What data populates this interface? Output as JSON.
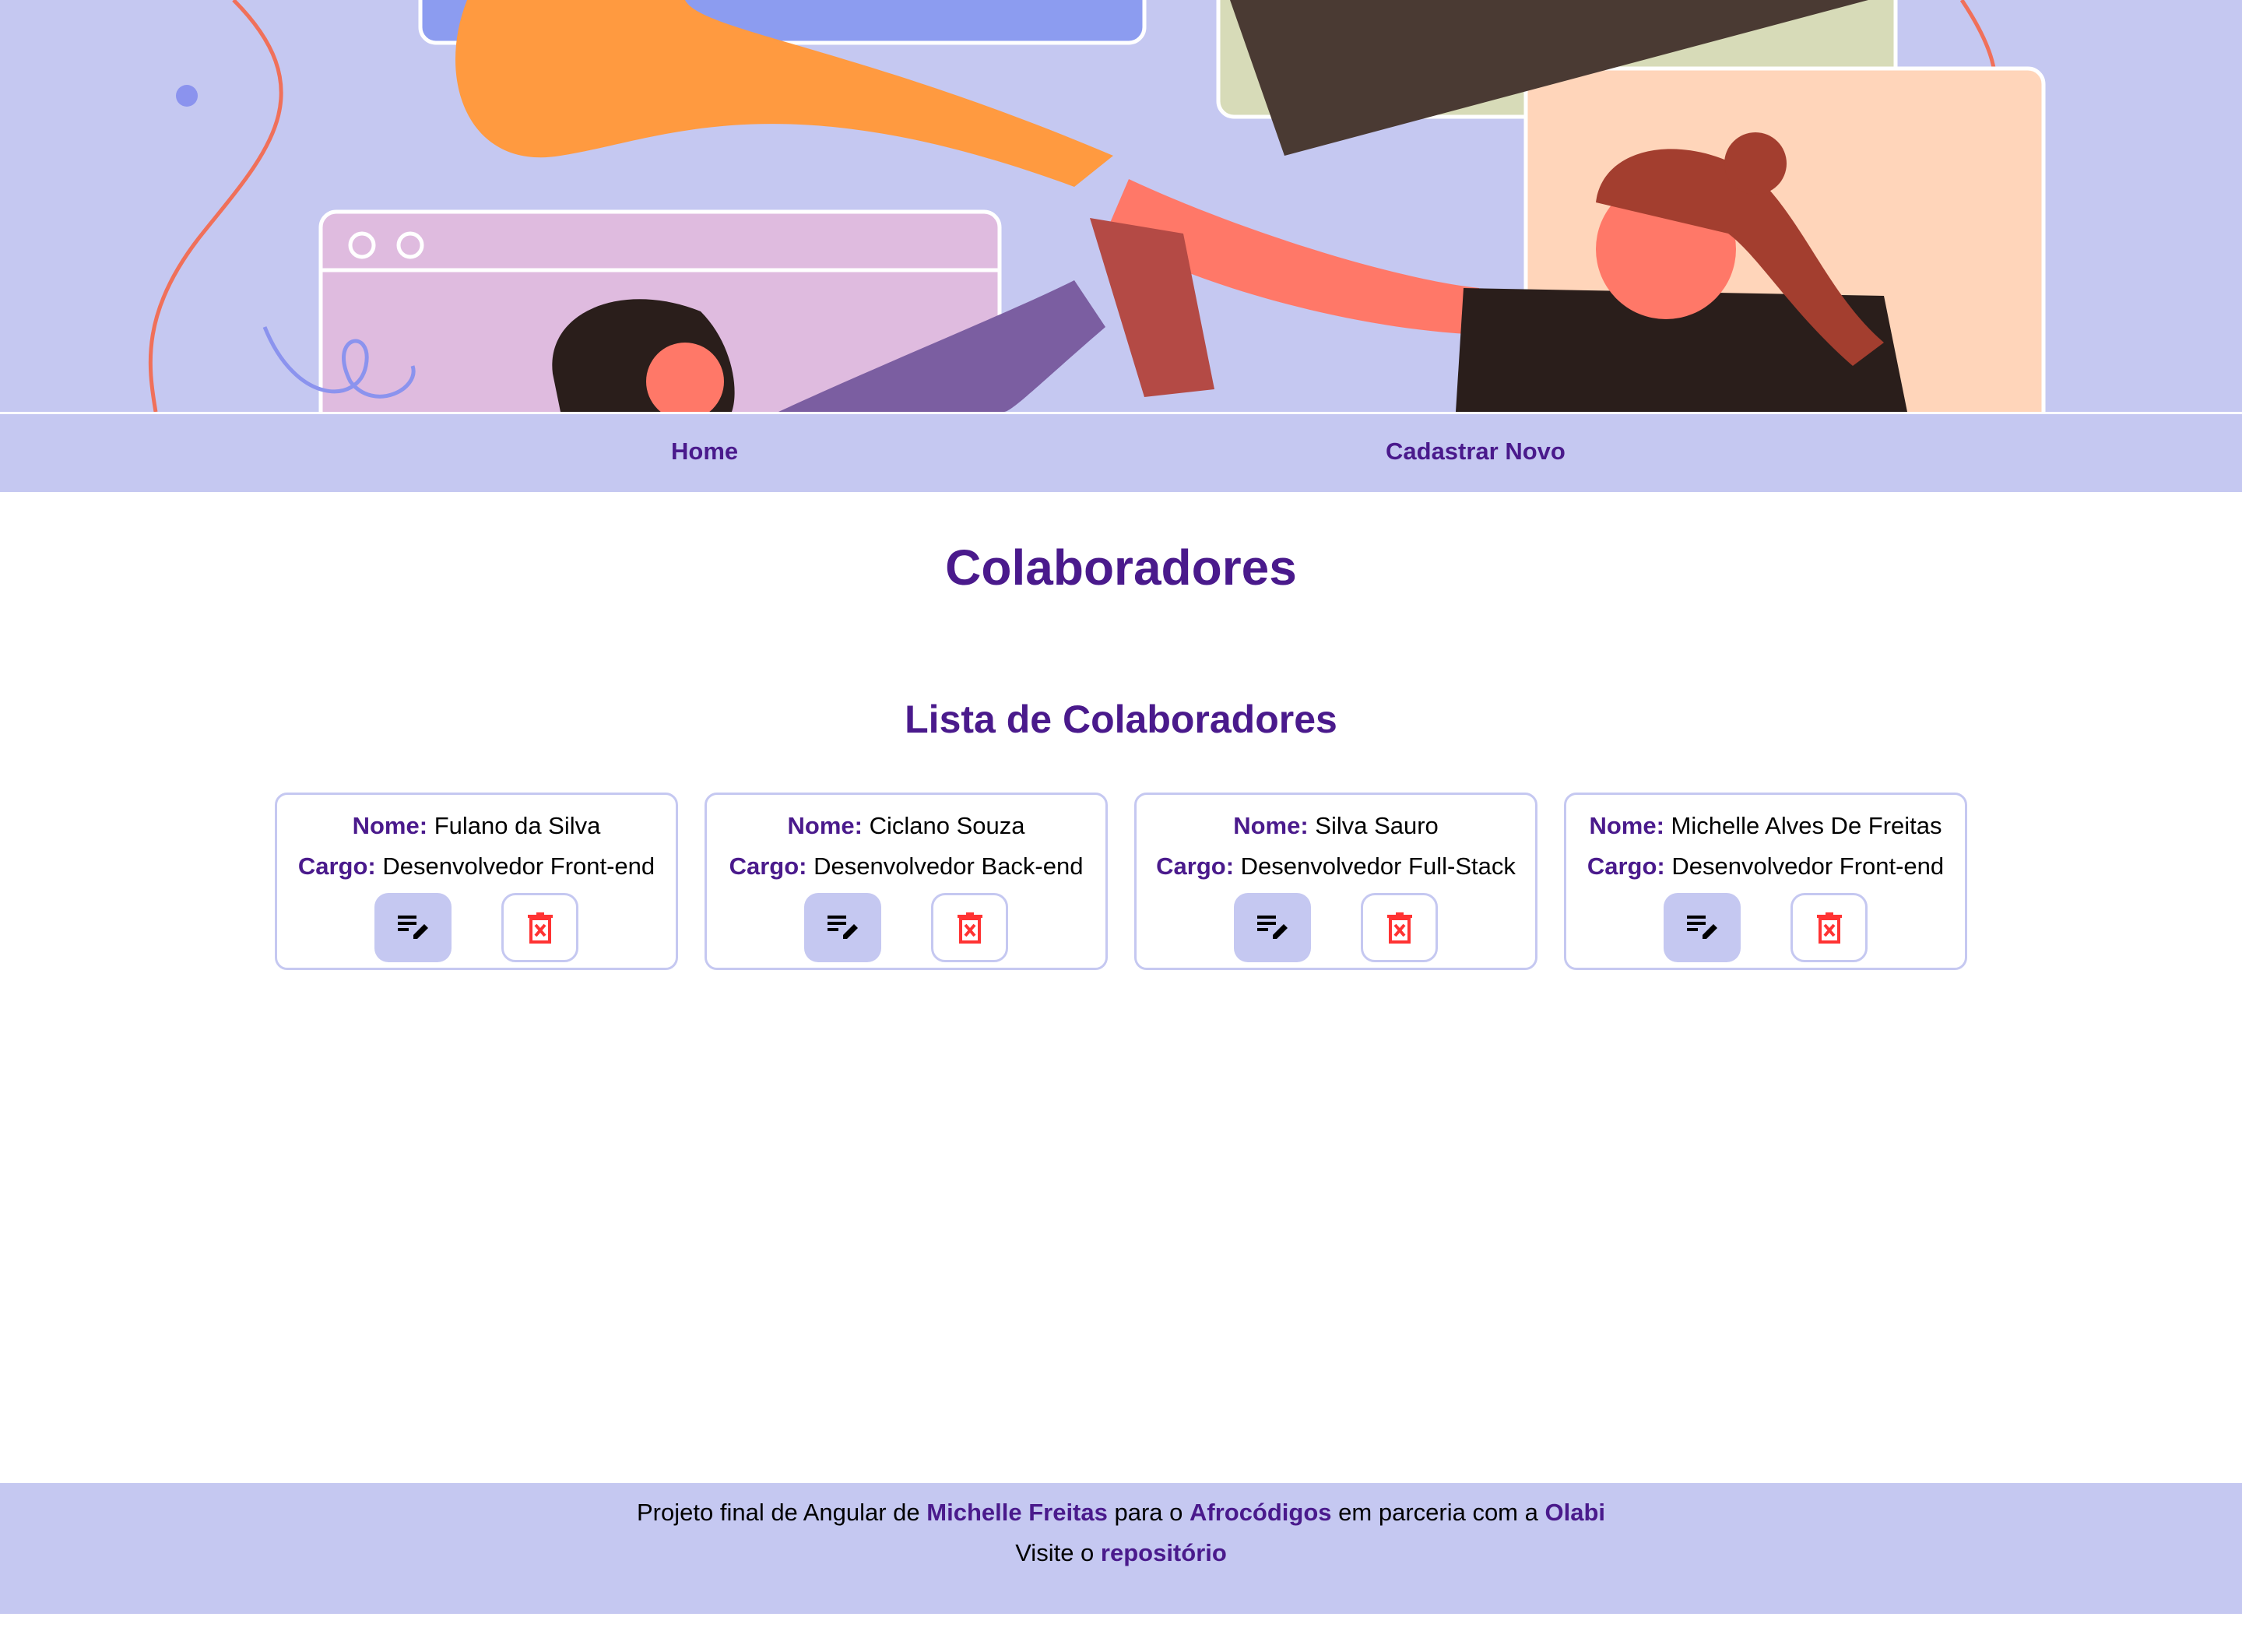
{
  "nav": {
    "home": "Home",
    "cadastrar": "Cadastrar Novo"
  },
  "main": {
    "title": "Colaboradores",
    "subtitle": "Lista de Colaboradores",
    "labels": {
      "nome": "Nome:",
      "cargo": "Cargo:"
    },
    "colaboradores": [
      {
        "nome": "Fulano da Silva",
        "cargo": "Desenvolvedor Front-end"
      },
      {
        "nome": "Ciclano Souza",
        "cargo": "Desenvolvedor Back-end"
      },
      {
        "nome": "Silva Sauro",
        "cargo": "Desenvolvedor Full-Stack"
      },
      {
        "nome": "Michelle Alves De Freitas",
        "cargo": "Desenvolvedor Front-end"
      }
    ],
    "icons": {
      "edit": "edit-note-icon",
      "delete": "trash-x-icon"
    }
  },
  "footer": {
    "t1": "Projeto final de Angular de ",
    "author": "Michelle Freitas",
    "t2": " para o ",
    "org": "Afrocódigos",
    "t3": " em parceria com a ",
    "partner": "Olabi",
    "t4": "Visite o ",
    "repo": "repositório"
  },
  "colors": {
    "accent": "#4a1a8c",
    "bg": "#c5c8f1",
    "danger": "#ff3333"
  }
}
